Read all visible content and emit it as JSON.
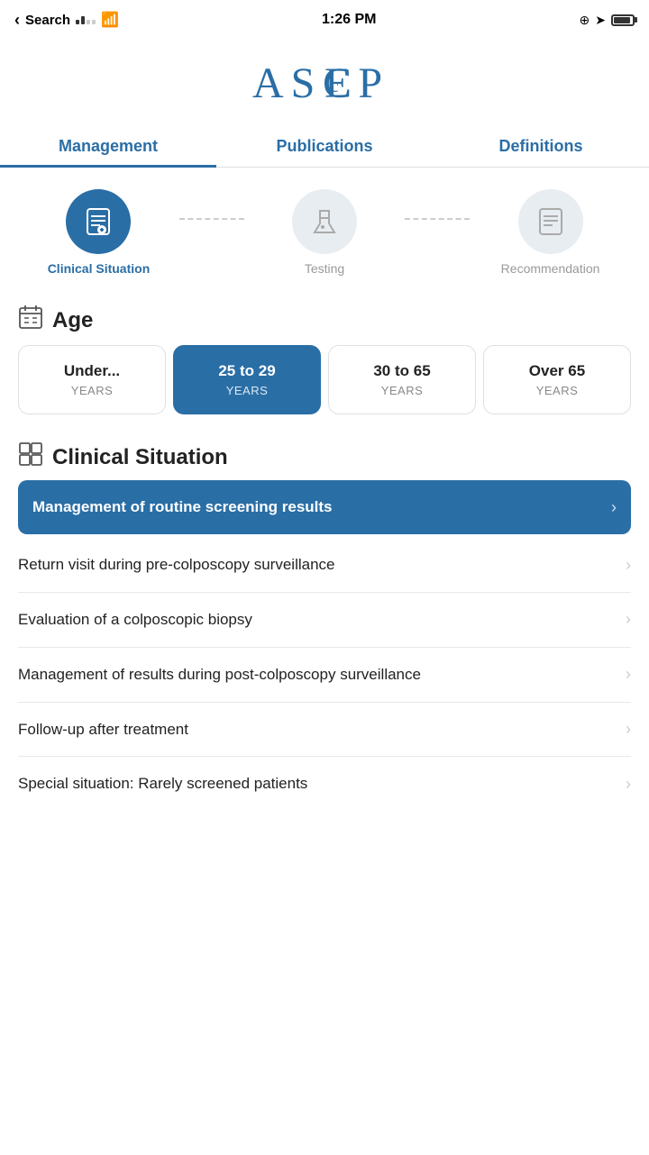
{
  "statusBar": {
    "carrier": "Search",
    "time": "1:26 PM",
    "signal": 2,
    "wifi": true,
    "battery": 80
  },
  "logo": "ASCEP",
  "nav": {
    "tabs": [
      {
        "id": "management",
        "label": "Management",
        "active": true
      },
      {
        "id": "publications",
        "label": "Publications",
        "active": false
      },
      {
        "id": "definitions",
        "label": "Definitions",
        "active": false
      }
    ]
  },
  "wizard": {
    "steps": [
      {
        "id": "clinical-situation",
        "label": "Clinical Situation",
        "active": true
      },
      {
        "id": "testing",
        "label": "Testing",
        "active": false
      },
      {
        "id": "recommendation",
        "label": "Recommendation",
        "active": false
      }
    ]
  },
  "age": {
    "sectionLabel": "Age",
    "options": [
      {
        "id": "under25",
        "range": "Under...",
        "unit": "YEARS",
        "selected": false
      },
      {
        "id": "25to29",
        "range": "25 to 29",
        "unit": "YEARS",
        "selected": true
      },
      {
        "id": "30to65",
        "range": "30 to 65",
        "unit": "YEARS",
        "selected": false
      },
      {
        "id": "over65",
        "range": "Over 65",
        "unit": "YEARS",
        "selected": false
      }
    ]
  },
  "clinicalSituation": {
    "sectionLabel": "Clinical Situation",
    "items": [
      {
        "id": "routine-screening",
        "text": "Management of routine screening results",
        "highlighted": true
      },
      {
        "id": "return-visit",
        "text": "Return visit during pre-colposcopy surveillance",
        "highlighted": false
      },
      {
        "id": "colposcopic-biopsy",
        "text": "Evaluation of a colposcopic biopsy",
        "highlighted": false
      },
      {
        "id": "post-colposcopy",
        "text": "Management of results during post-colposcopy surveillance",
        "highlighted": false
      },
      {
        "id": "follow-up",
        "text": "Follow-up after treatment",
        "highlighted": false
      },
      {
        "id": "special-situation",
        "text": "Special situation: Rarely screened patients",
        "highlighted": false
      }
    ]
  }
}
